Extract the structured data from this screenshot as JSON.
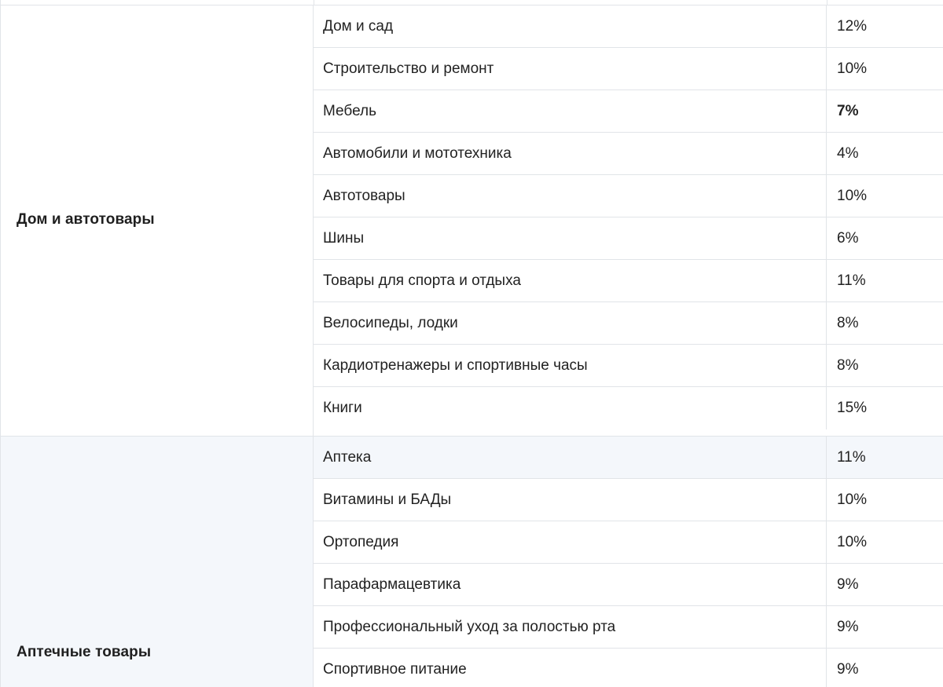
{
  "groups": [
    {
      "label": "Дом и автотовары",
      "rows": [
        {
          "category": "Дом и сад",
          "percent": "12%",
          "bold": false
        },
        {
          "category": "Строительство и ремонт",
          "percent": "10%",
          "bold": false
        },
        {
          "category": "Мебель",
          "percent": "7%",
          "bold": true
        },
        {
          "category": "Автомобили и мототехника",
          "percent": "4%",
          "bold": false
        },
        {
          "category": "Автотовары",
          "percent": "10%",
          "bold": false
        },
        {
          "category": "Шины",
          "percent": "6%",
          "bold": false
        },
        {
          "category": "Товары для спорта и отдыха",
          "percent": "11%",
          "bold": false
        },
        {
          "category": "Велосипеды, лодки",
          "percent": "8%",
          "bold": false
        },
        {
          "category": "Кардиотренажеры и спортивные часы",
          "percent": "8%",
          "bold": false
        },
        {
          "category": "Книги",
          "percent": "15%",
          "bold": false
        }
      ]
    },
    {
      "label": "Аптечные товары",
      "rows": [
        {
          "category": "Аптека",
          "percent": "11%",
          "bold": false
        },
        {
          "category": "Витамины и БАДы",
          "percent": "10%",
          "bold": false
        },
        {
          "category": "Ортопедия",
          "percent": "10%",
          "bold": false
        },
        {
          "category": "Парафармацевтика",
          "percent": "9%",
          "bold": false
        },
        {
          "category": "Профессиональный уход за полостью рта",
          "percent": "9%",
          "bold": false
        },
        {
          "category": "Спортивное питание",
          "percent": "9%",
          "bold": false
        }
      ]
    }
  ]
}
